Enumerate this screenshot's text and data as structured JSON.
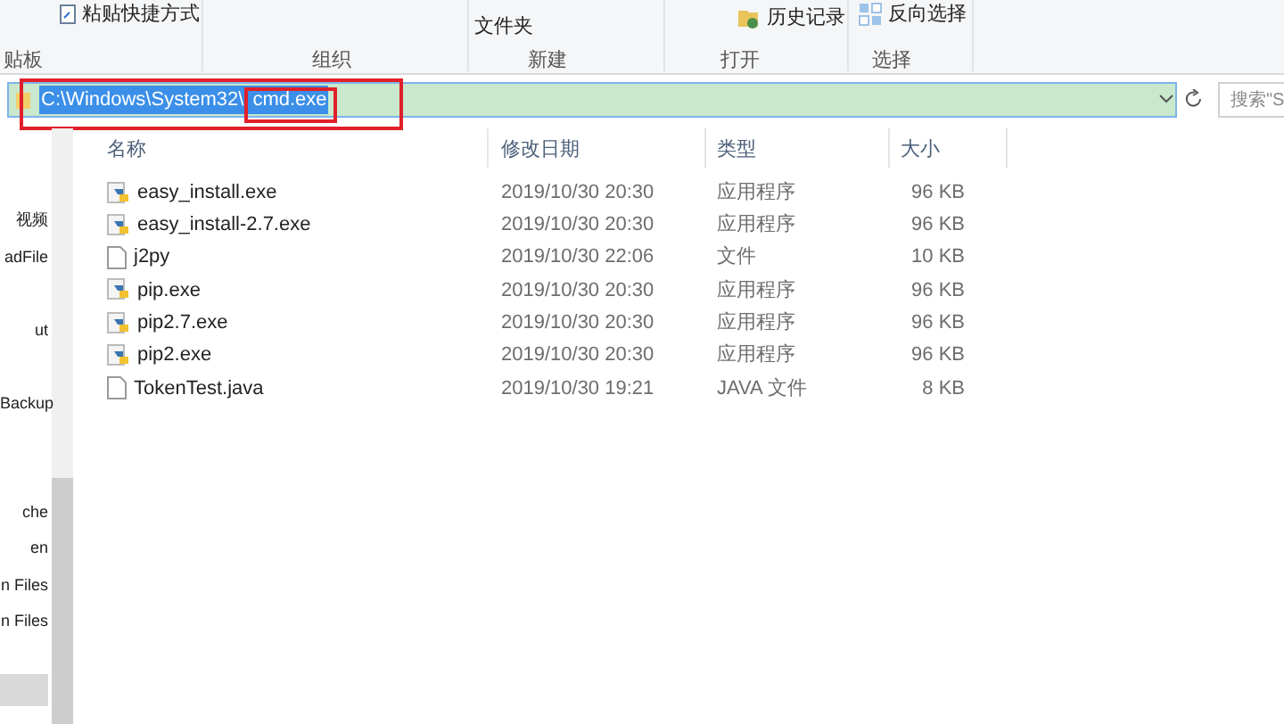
{
  "ribbon": {
    "buttons": [
      {
        "label": "粘贴快捷方式"
      },
      {
        "label": "文件夹"
      },
      {
        "label": "历史记录"
      },
      {
        "label": "反向选择"
      }
    ],
    "groups": [
      "贴板",
      "组织",
      "新建",
      "打开",
      "选择"
    ]
  },
  "address_bar": {
    "path": "C:\\Windows\\System32\\",
    "selected_part": "cmd.exe",
    "search_placeholder": "搜索\"S"
  },
  "nav_pane": {
    "items": [
      {
        "label": "视频",
        "selected": false
      },
      {
        "label": "adFile",
        "selected": false
      },
      {
        "label": "ut",
        "selected": false
      },
      {
        "label": "Backup",
        "selected": false
      },
      {
        "label": "che",
        "selected": false
      },
      {
        "label": "en",
        "selected": false
      },
      {
        "label": "n Files",
        "selected": false
      },
      {
        "label": "n Files",
        "selected": false
      },
      {
        "selected": true
      }
    ]
  },
  "table": {
    "columns": [
      "名称",
      "修改日期",
      "类型",
      "大小"
    ],
    "rows": [
      {
        "kind": "python",
        "name": "easy_install.exe",
        "date": "2019/10/30 20:30",
        "type": "应用程序",
        "size": "96 KB"
      },
      {
        "kind": "python",
        "name": "easy_install-2.7.exe",
        "date": "2019/10/30 20:30",
        "type": "应用程序",
        "size": "96 KB"
      },
      {
        "kind": "file",
        "name": "j2py",
        "date": "2019/10/30 22:06",
        "type": "文件",
        "size": "10 KB"
      },
      {
        "kind": "python",
        "name": "pip.exe",
        "date": "2019/10/30 20:30",
        "type": "应用程序",
        "size": "96 KB"
      },
      {
        "kind": "python",
        "name": "pip2.7.exe",
        "date": "2019/10/30 20:30",
        "type": "应用程序",
        "size": "96 KB"
      },
      {
        "kind": "python",
        "name": "pip2.exe",
        "date": "2019/10/30 20:30",
        "type": "应用程序",
        "size": "96 KB"
      },
      {
        "kind": "file",
        "name": "TokenTest.java",
        "date": "2019/10/30 19:21",
        "type": "JAVA 文件",
        "size": "8 KB"
      }
    ]
  }
}
